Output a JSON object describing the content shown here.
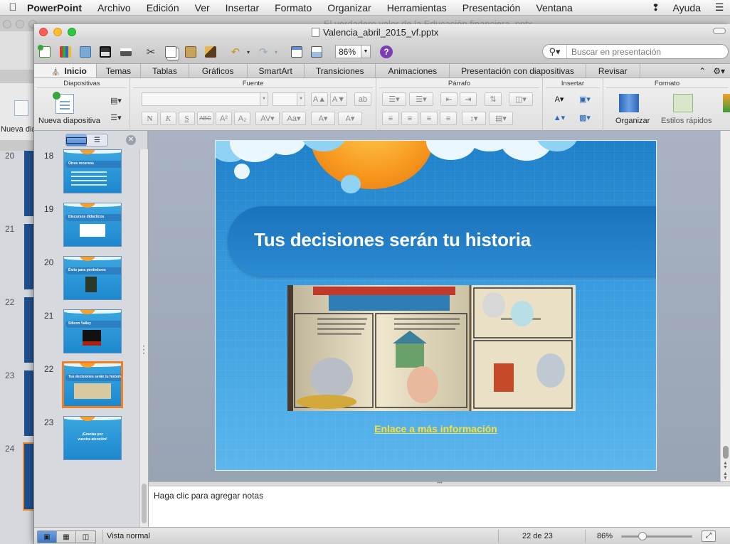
{
  "menubar": {
    "app_name": "PowerPoint",
    "items": [
      "Archivo",
      "Edición",
      "Ver",
      "Insertar",
      "Formato",
      "Organizar",
      "Herramientas",
      "Presentación",
      "Ventana",
      "Ayuda"
    ]
  },
  "background_window": {
    "title": "El verdadero valor de la Educación financiera .pptx",
    "new_slide_label": "Nueva diapositiva",
    "slide_numbers": [
      "20",
      "21",
      "22",
      "23",
      "24"
    ]
  },
  "window": {
    "title": "Valencia_abril_2015_vf.pptx"
  },
  "toolbar": {
    "zoom_value": "86%",
    "search_placeholder": "Buscar en presentación"
  },
  "ribbon_tabs": [
    "Inicio",
    "Temas",
    "Tablas",
    "Gráficos",
    "SmartArt",
    "Transiciones",
    "Animaciones",
    "Presentación con diapositivas",
    "Revisar"
  ],
  "ribbon_groups": {
    "diapositivas": "Diapositivas",
    "fuente": "Fuente",
    "parrafo": "Párrafo",
    "insertar": "Insertar",
    "formato": "Formato"
  },
  "ribbon_buttons": {
    "new_slide": "Nueva diapositiva",
    "arrange": "Organizar",
    "quick_styles": "Estilos rápidos"
  },
  "thumbnails": [
    {
      "num": "18",
      "title": "Otros recursos"
    },
    {
      "num": "19",
      "title": "Discursos didácticos"
    },
    {
      "num": "20",
      "title": "Éxito para perdedores"
    },
    {
      "num": "21",
      "title": "Silicon Valley"
    },
    {
      "num": "22",
      "title": "Tus decisiones serán tu historia"
    },
    {
      "num": "23",
      "title": "¡Gracias por vuestra atención!"
    }
  ],
  "slide": {
    "title": "Tus decisiones serán tu historia",
    "link_text": "Enlace a más información "
  },
  "notes": {
    "placeholder": "Haga clic para agregar notas"
  },
  "status": {
    "view_name": "Vista normal",
    "page": "22 de 23",
    "zoom": "86%",
    "zoom_fraction": 0.3
  },
  "colors": {
    "accent_selection": "#ef7f22",
    "slide_link": "#f7e03a",
    "slide_banner": "#1a72bd"
  }
}
